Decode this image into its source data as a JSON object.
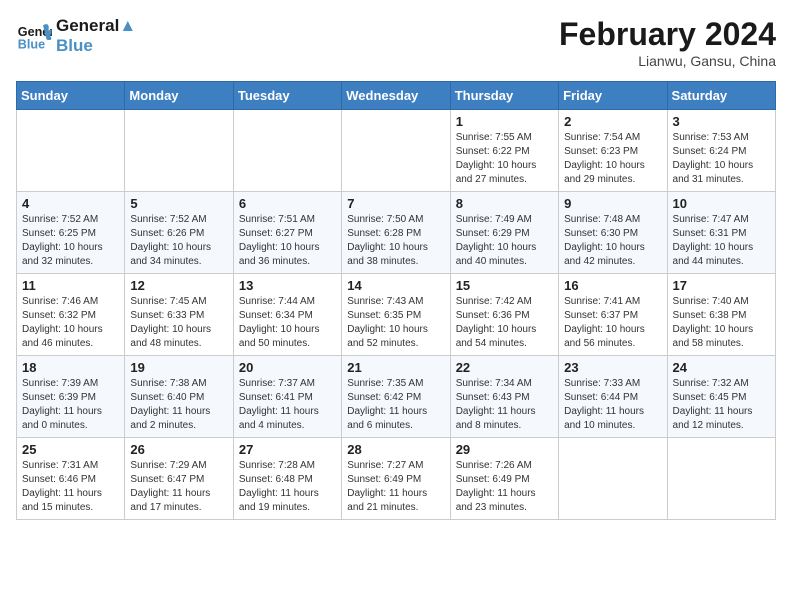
{
  "header": {
    "logo_line1": "General",
    "logo_line2": "Blue",
    "month_year": "February 2024",
    "location": "Lianwu, Gansu, China"
  },
  "weekdays": [
    "Sunday",
    "Monday",
    "Tuesday",
    "Wednesday",
    "Thursday",
    "Friday",
    "Saturday"
  ],
  "weeks": [
    [
      {
        "day": "",
        "info": ""
      },
      {
        "day": "",
        "info": ""
      },
      {
        "day": "",
        "info": ""
      },
      {
        "day": "",
        "info": ""
      },
      {
        "day": "1",
        "info": "Sunrise: 7:55 AM\nSunset: 6:22 PM\nDaylight: 10 hours\nand 27 minutes."
      },
      {
        "day": "2",
        "info": "Sunrise: 7:54 AM\nSunset: 6:23 PM\nDaylight: 10 hours\nand 29 minutes."
      },
      {
        "day": "3",
        "info": "Sunrise: 7:53 AM\nSunset: 6:24 PM\nDaylight: 10 hours\nand 31 minutes."
      }
    ],
    [
      {
        "day": "4",
        "info": "Sunrise: 7:52 AM\nSunset: 6:25 PM\nDaylight: 10 hours\nand 32 minutes."
      },
      {
        "day": "5",
        "info": "Sunrise: 7:52 AM\nSunset: 6:26 PM\nDaylight: 10 hours\nand 34 minutes."
      },
      {
        "day": "6",
        "info": "Sunrise: 7:51 AM\nSunset: 6:27 PM\nDaylight: 10 hours\nand 36 minutes."
      },
      {
        "day": "7",
        "info": "Sunrise: 7:50 AM\nSunset: 6:28 PM\nDaylight: 10 hours\nand 38 minutes."
      },
      {
        "day": "8",
        "info": "Sunrise: 7:49 AM\nSunset: 6:29 PM\nDaylight: 10 hours\nand 40 minutes."
      },
      {
        "day": "9",
        "info": "Sunrise: 7:48 AM\nSunset: 6:30 PM\nDaylight: 10 hours\nand 42 minutes."
      },
      {
        "day": "10",
        "info": "Sunrise: 7:47 AM\nSunset: 6:31 PM\nDaylight: 10 hours\nand 44 minutes."
      }
    ],
    [
      {
        "day": "11",
        "info": "Sunrise: 7:46 AM\nSunset: 6:32 PM\nDaylight: 10 hours\nand 46 minutes."
      },
      {
        "day": "12",
        "info": "Sunrise: 7:45 AM\nSunset: 6:33 PM\nDaylight: 10 hours\nand 48 minutes."
      },
      {
        "day": "13",
        "info": "Sunrise: 7:44 AM\nSunset: 6:34 PM\nDaylight: 10 hours\nand 50 minutes."
      },
      {
        "day": "14",
        "info": "Sunrise: 7:43 AM\nSunset: 6:35 PM\nDaylight: 10 hours\nand 52 minutes."
      },
      {
        "day": "15",
        "info": "Sunrise: 7:42 AM\nSunset: 6:36 PM\nDaylight: 10 hours\nand 54 minutes."
      },
      {
        "day": "16",
        "info": "Sunrise: 7:41 AM\nSunset: 6:37 PM\nDaylight: 10 hours\nand 56 minutes."
      },
      {
        "day": "17",
        "info": "Sunrise: 7:40 AM\nSunset: 6:38 PM\nDaylight: 10 hours\nand 58 minutes."
      }
    ],
    [
      {
        "day": "18",
        "info": "Sunrise: 7:39 AM\nSunset: 6:39 PM\nDaylight: 11 hours\nand 0 minutes."
      },
      {
        "day": "19",
        "info": "Sunrise: 7:38 AM\nSunset: 6:40 PM\nDaylight: 11 hours\nand 2 minutes."
      },
      {
        "day": "20",
        "info": "Sunrise: 7:37 AM\nSunset: 6:41 PM\nDaylight: 11 hours\nand 4 minutes."
      },
      {
        "day": "21",
        "info": "Sunrise: 7:35 AM\nSunset: 6:42 PM\nDaylight: 11 hours\nand 6 minutes."
      },
      {
        "day": "22",
        "info": "Sunrise: 7:34 AM\nSunset: 6:43 PM\nDaylight: 11 hours\nand 8 minutes."
      },
      {
        "day": "23",
        "info": "Sunrise: 7:33 AM\nSunset: 6:44 PM\nDaylight: 11 hours\nand 10 minutes."
      },
      {
        "day": "24",
        "info": "Sunrise: 7:32 AM\nSunset: 6:45 PM\nDaylight: 11 hours\nand 12 minutes."
      }
    ],
    [
      {
        "day": "25",
        "info": "Sunrise: 7:31 AM\nSunset: 6:46 PM\nDaylight: 11 hours\nand 15 minutes."
      },
      {
        "day": "26",
        "info": "Sunrise: 7:29 AM\nSunset: 6:47 PM\nDaylight: 11 hours\nand 17 minutes."
      },
      {
        "day": "27",
        "info": "Sunrise: 7:28 AM\nSunset: 6:48 PM\nDaylight: 11 hours\nand 19 minutes."
      },
      {
        "day": "28",
        "info": "Sunrise: 7:27 AM\nSunset: 6:49 PM\nDaylight: 11 hours\nand 21 minutes."
      },
      {
        "day": "29",
        "info": "Sunrise: 7:26 AM\nSunset: 6:49 PM\nDaylight: 11 hours\nand 23 minutes."
      },
      {
        "day": "",
        "info": ""
      },
      {
        "day": "",
        "info": ""
      }
    ]
  ]
}
